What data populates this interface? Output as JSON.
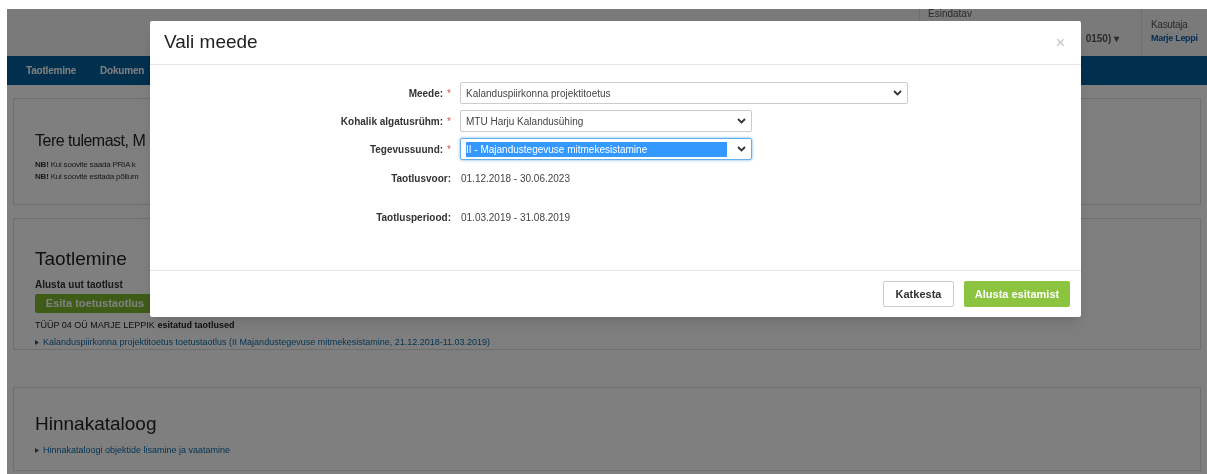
{
  "header": {
    "representative_label": "Esindatav",
    "representative_value": "0150) ▾",
    "user_label": "Kasutaja",
    "user_name": "Marje Leppi"
  },
  "nav": {
    "items": [
      "Taotlemine",
      "Dokumen"
    ]
  },
  "welcome": {
    "title": "Tere tulemast, M",
    "notes": [
      {
        "strong": "NB!",
        "text": "Kui soovite saada PRIA k"
      },
      {
        "strong": "NB!",
        "text": "Kui soovite esitada põllum"
      }
    ]
  },
  "applications": {
    "title": "Taotlemine",
    "subtitle": "Alusta uut taotlust",
    "button": "Esita toetustaotlus",
    "list_title": "TÜÜP 04 OÜ MARJE LEPPIK **esitatud taotlused**",
    "links": [
      "Kalanduspiirkonna projektitoetus toetustaotlus (II Majandustegevuse mitmekesistamine, 21.12.2018-11.03.2019)"
    ]
  },
  "catalog": {
    "title": "Hinnakataloog",
    "links": [
      "Hinnakataloogi objektide lisamine ja vaatamine"
    ]
  },
  "modal": {
    "title": "Vali meede",
    "close": "×",
    "fields": [
      {
        "kind": "select",
        "label": "Meede:",
        "required_mark": "*",
        "value": "Kalanduspiirkonna projektitoetus",
        "wide": true,
        "focused": false
      },
      {
        "kind": "select",
        "label": "Kohalik algatusrühm:",
        "required_mark": "*",
        "value": "MTU Harju Kalandusühing",
        "wide": false,
        "focused": false
      },
      {
        "kind": "select",
        "label": "Tegevussuund:",
        "required_mark": "*",
        "value": "II - Majandustegevuse mitmekesistamine",
        "wide": false,
        "focused": true
      },
      {
        "kind": "text",
        "label": "Taotlusvoor:",
        "value": "01.12.2018 - 30.06.2023"
      },
      {
        "kind": "text",
        "label": "Taotlusperiood:",
        "value": "01.03.2019 - 31.08.2019"
      }
    ],
    "buttons": [
      {
        "kind": "secondary",
        "label": "Katkesta"
      },
      {
        "kind": "primary",
        "label": "Alusta esitamist"
      }
    ]
  }
}
